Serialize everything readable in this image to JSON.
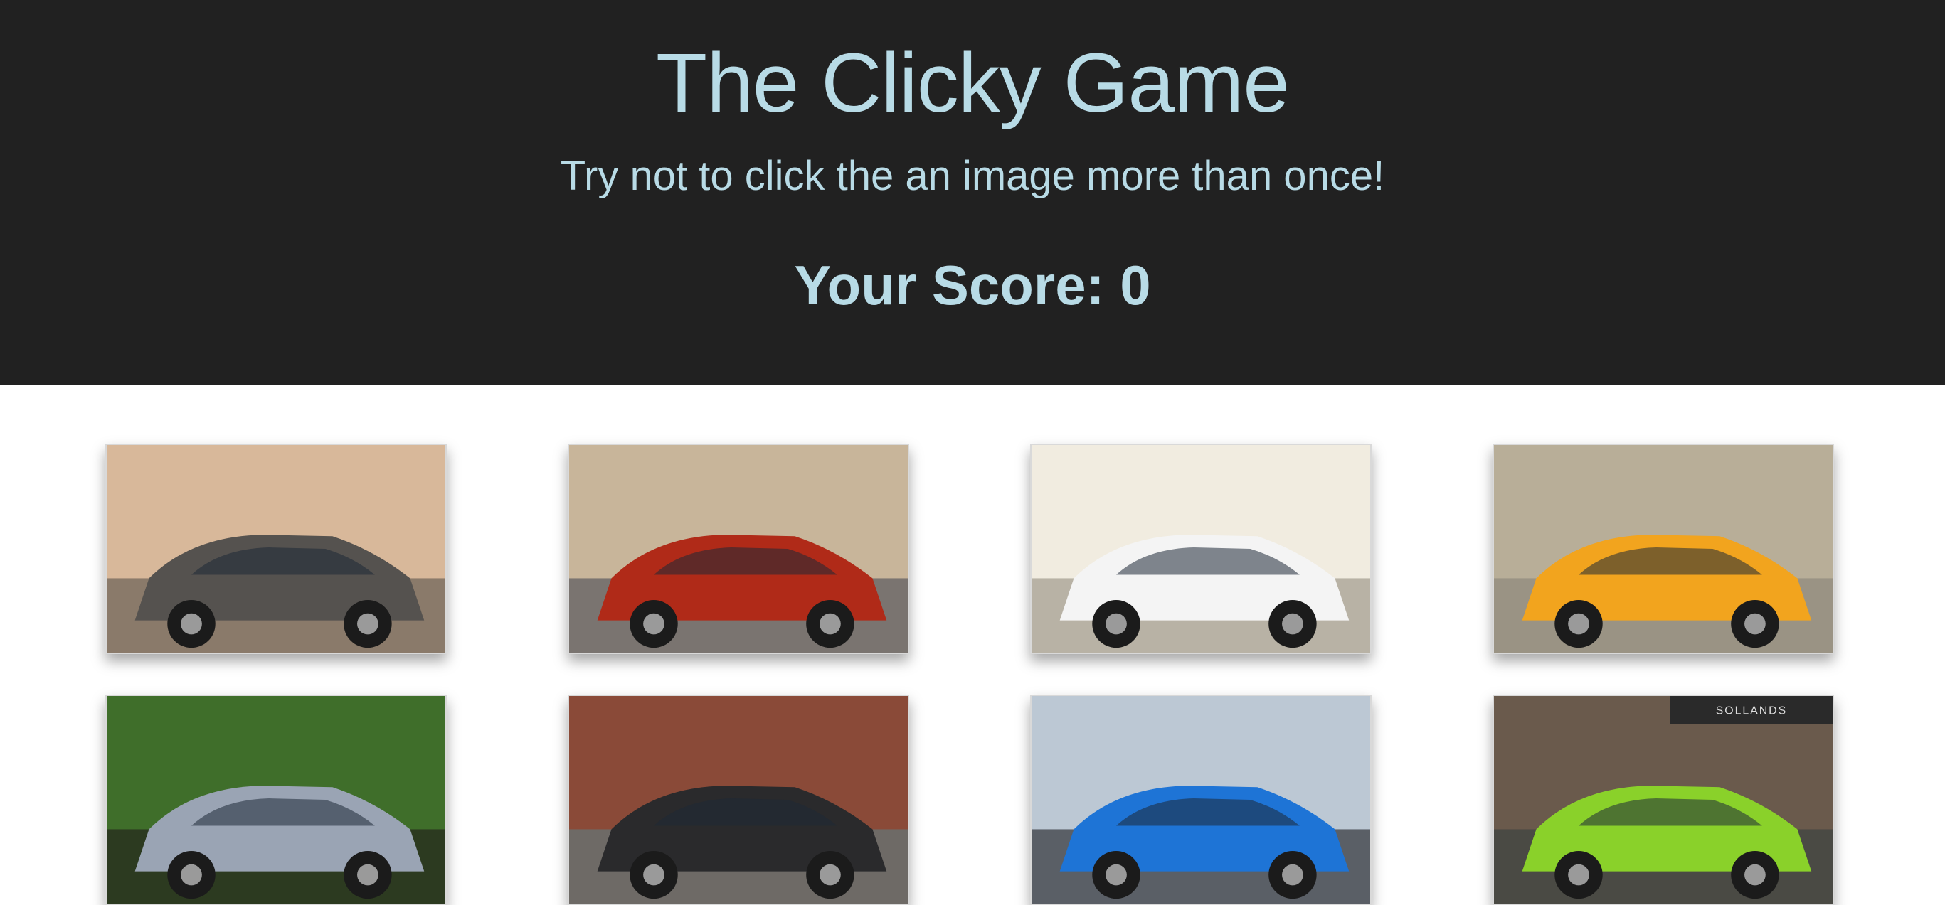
{
  "header": {
    "title": "The Clicky Game",
    "subtitle": "Try not to click the an image more than once!",
    "score_label": "Your Score: 0",
    "score": 0,
    "background_color": "#212121",
    "text_color": "#b8dbe6"
  },
  "cards": [
    {
      "name": "gray-toyota-tacoma-truck-image",
      "sign": "",
      "colors": {
        "sky": "#d8b89a",
        "ground": "#8a7a6a",
        "car": "#55524f"
      }
    },
    {
      "name": "red-classic-chevrolet-image",
      "sign": "",
      "colors": {
        "sky": "#c8b59a",
        "ground": "#7a7470",
        "car": "#b02a18"
      }
    },
    {
      "name": "white-sedan-city-skyline-image",
      "sign": "",
      "colors": {
        "sky": "#f1ece0",
        "ground": "#b8b2a5",
        "car": "#f4f4f4"
      }
    },
    {
      "name": "yellow-lamborghini-image",
      "sign": "",
      "colors": {
        "sky": "#b8ae98",
        "ground": "#9a9384",
        "car": "#f2a41e"
      }
    },
    {
      "name": "silver-car-under-trees-image",
      "sign": "",
      "colors": {
        "sky": "#3f6e2a",
        "ground": "#2c3a20",
        "car": "#9aa4b4"
      }
    },
    {
      "name": "black-car-brick-building-image",
      "sign": "",
      "colors": {
        "sky": "#8a4a38",
        "ground": "#6e6a66",
        "car": "#2a2a2c"
      }
    },
    {
      "name": "mustang-and-blue-focus-image",
      "sign": "",
      "colors": {
        "sky": "#bcc8d4",
        "ground": "#5a5f66",
        "car": "#1e74d6"
      }
    },
    {
      "name": "green-lamborghini-sollands-image",
      "sign": "SOLLANDS",
      "colors": {
        "sky": "#6a5a4c",
        "ground": "#4a4a44",
        "car": "#8ad12a"
      }
    }
  ]
}
